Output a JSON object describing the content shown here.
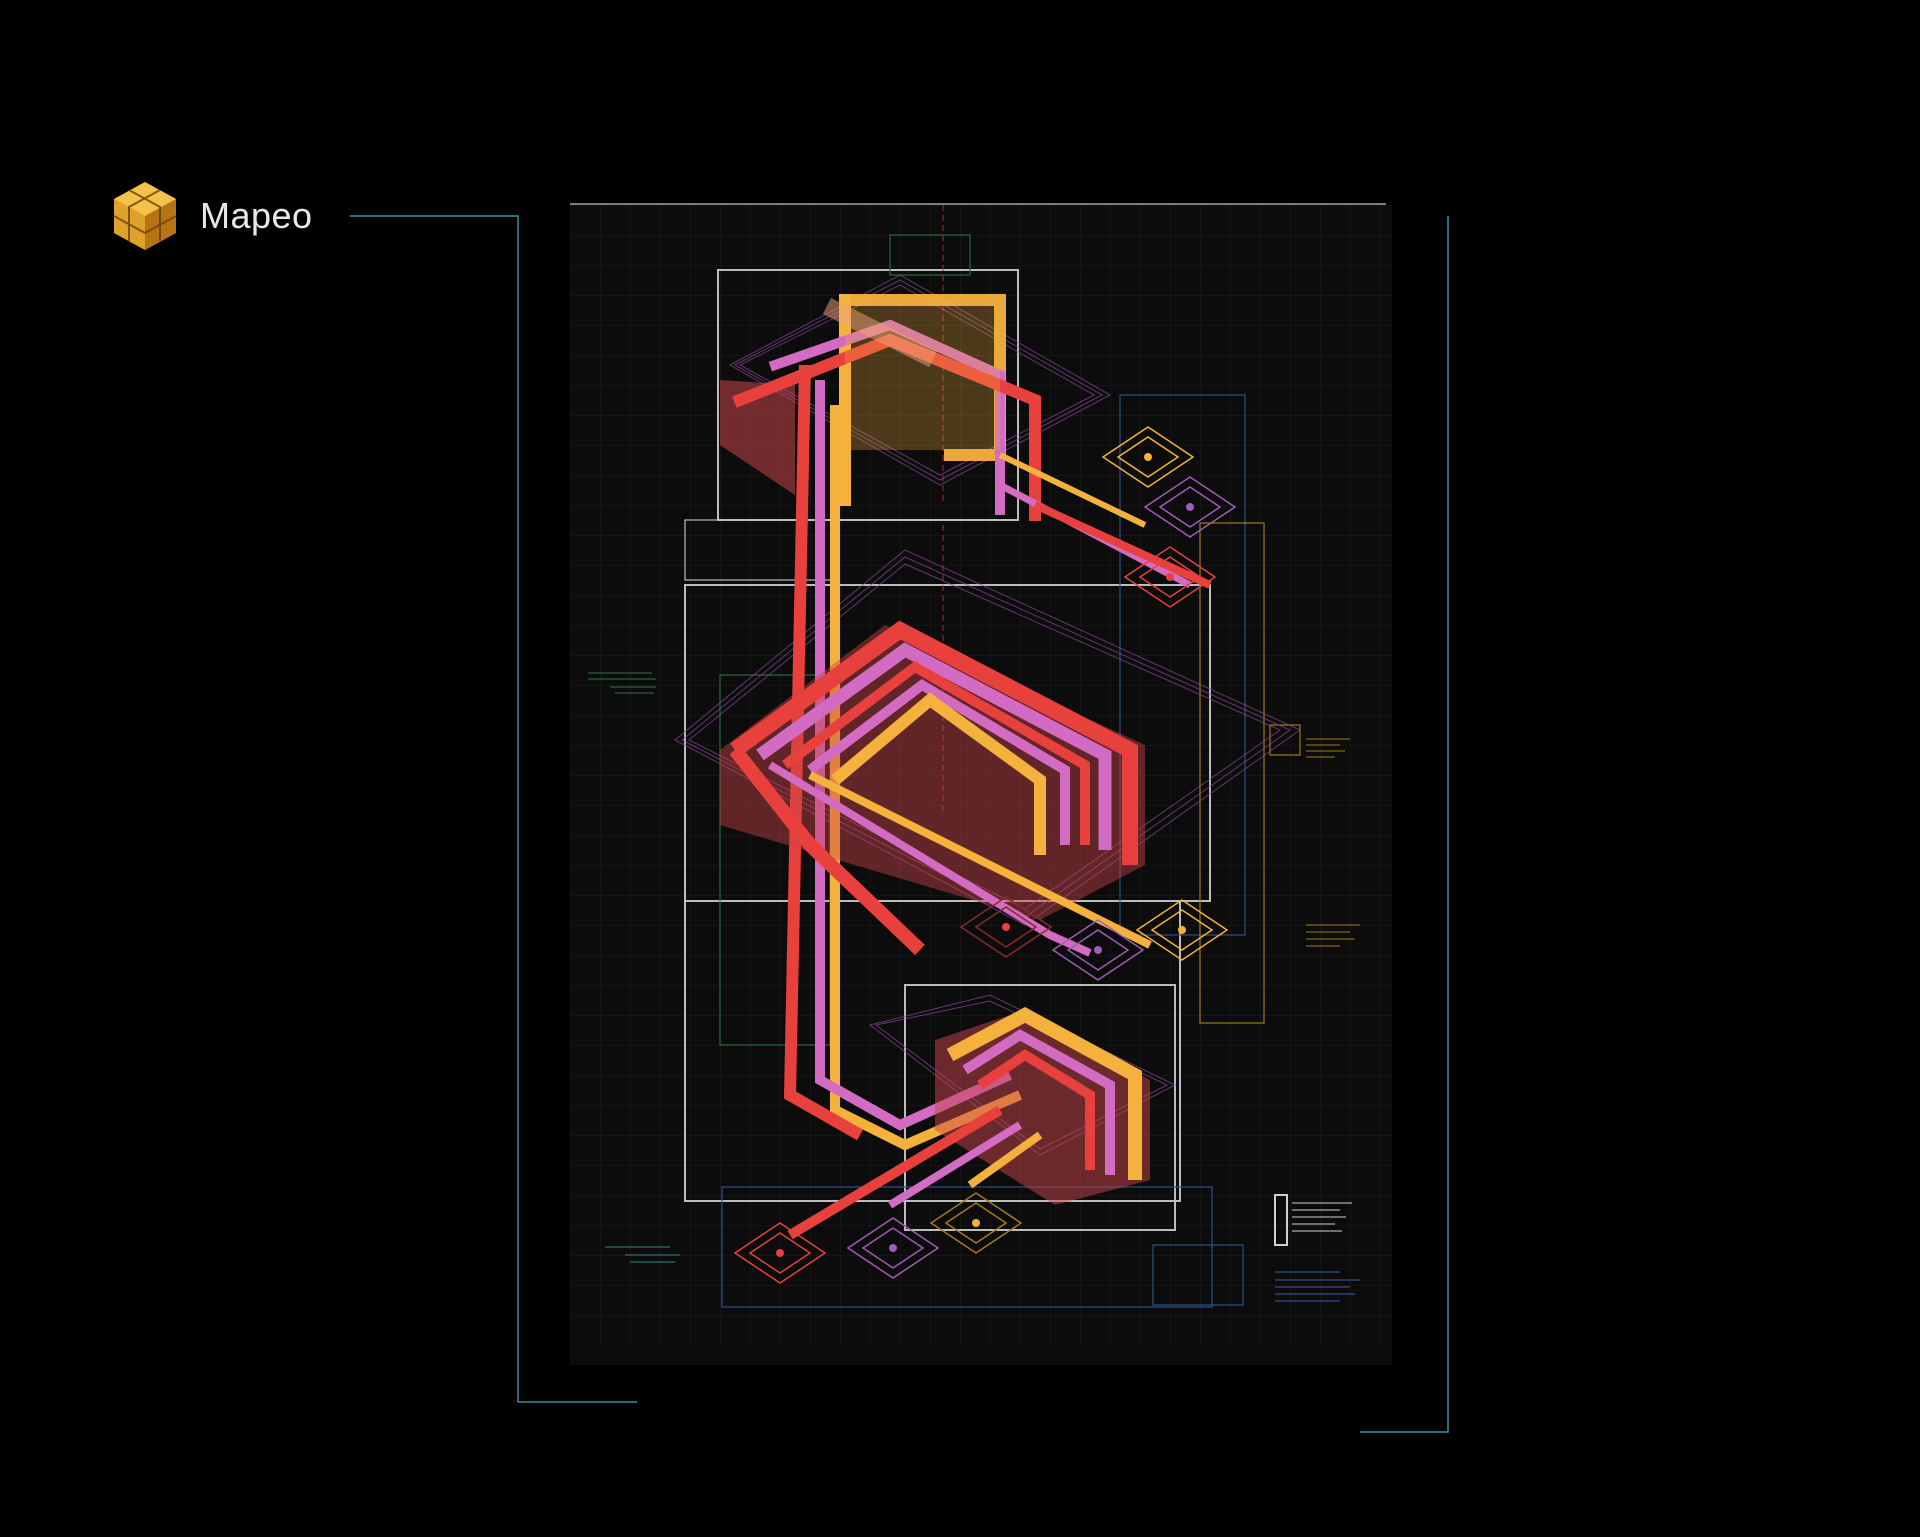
{
  "brand": {
    "title": "Mapeo",
    "logo_icon": "isometric-cube-icon",
    "accent": "#f2b233"
  },
  "colors": {
    "background": "#000000",
    "poster": "#0c0c0c",
    "frame_line": "#3a8fa3",
    "yellow": "#f5b13d",
    "pink": "#d26bc1",
    "red": "#e8403d",
    "purple": "#a05cb8",
    "grid": "#1e1e1e",
    "box_outline": "#bdbdbd",
    "blue_outline": "#2f4f86",
    "green_outline": "#2a6b3a",
    "orange_outline": "#a07a1f"
  },
  "diagram": {
    "icon": "isometric-layered-pipes-diagram",
    "nodes": [
      "yellow-node",
      "purple-node",
      "red-node",
      "yellow-node",
      "purple-node",
      "red-node",
      "red-node",
      "purple-node",
      "yellow-node"
    ]
  }
}
